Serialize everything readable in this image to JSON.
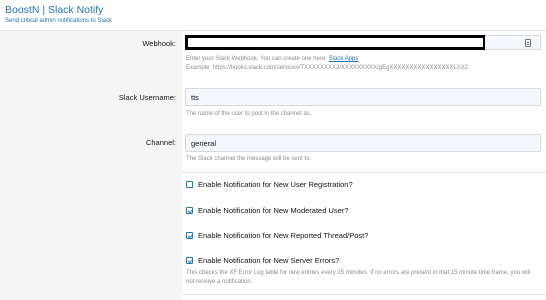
{
  "header": {
    "title": "BoostN | Slack Notify",
    "description": "Send critical admin notifications to Slack"
  },
  "webhook": {
    "label": "Webhook:",
    "value": "",
    "hint_prefix": "Enter your Slack Webhook. You can create one here: ",
    "hint_link": "Slack Apps",
    "hint_example": "Example: https://hooks.slack.com/services/TXXXXXXXX2/XXXXXXXXX/gEgXXXXXXXXXXXXXXXXLXX2"
  },
  "username": {
    "label": "Slack Username:",
    "value": "tts",
    "hint": "The name of the user to post in the channel as."
  },
  "channel": {
    "label": "Channel:",
    "value": "general",
    "hint": "The Slack channel the message will be sent to."
  },
  "options": [
    {
      "label": "Enable Notification for New User Registration?",
      "checked": false
    },
    {
      "label": "Enable Notification for New Moderated User?",
      "checked": true
    },
    {
      "label": "Enable Notification for New Reported Thread/Post?",
      "checked": true
    },
    {
      "label": "Enable Notification for New Server Errors?",
      "checked": true
    }
  ],
  "server_errors_hint": "This checks the XF Error Log table for new entries every 15 minutes. If no errors are present in that 15 minute time frame, you will not receive a notification.",
  "colors": {
    "accent": "#2577b1",
    "muted": "#8c8c8c",
    "field_bg": "#f5f8fc"
  },
  "icons": {
    "webhook_field": "clipboard-icon",
    "checkbox": "check-icon"
  }
}
